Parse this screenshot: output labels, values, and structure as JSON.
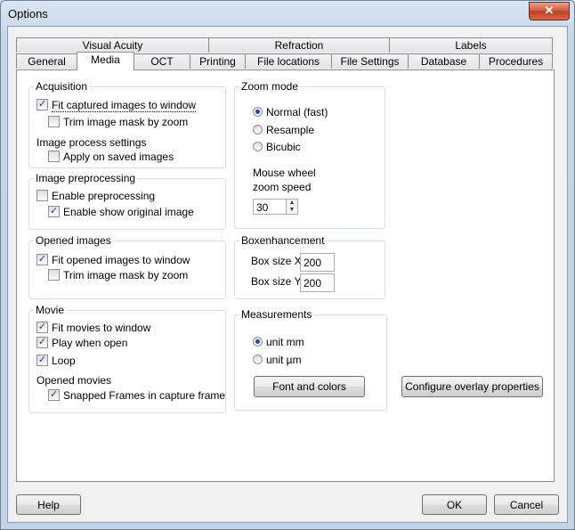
{
  "window": {
    "title": "Options",
    "close_glyph": "✕"
  },
  "tabs_row1": [
    "Visual Acuity",
    "Refraction",
    "Labels"
  ],
  "tabs_row2": [
    "General",
    "Media",
    "OCT",
    "Printing",
    "File locations",
    "File Settings",
    "Database",
    "Procedures"
  ],
  "active_tab": "Media",
  "acquisition": {
    "label": "Acquisition",
    "fit_captured": {
      "label": "Fit captured images to window",
      "checked": true
    },
    "trim_mask": {
      "label": "Trim image mask by zoom",
      "checked": false
    },
    "process_label": "Image process settings",
    "apply_saved": {
      "label": "Apply on saved images",
      "checked": false
    }
  },
  "preprocessing": {
    "label": "Image preprocessing",
    "enable": {
      "label": "Enable preprocessing",
      "checked": false
    },
    "show_original": {
      "label": "Enable show original image",
      "checked": true
    }
  },
  "opened": {
    "label": "Opened images",
    "fit_opened": {
      "label": "Fit opened images to window",
      "checked": true
    },
    "trim_mask": {
      "label": "Trim image mask by zoom",
      "checked": false
    }
  },
  "movie": {
    "label": "Movie",
    "fit_movies": {
      "label": "Fit movies to window",
      "checked": true
    },
    "play_open": {
      "label": "Play when open",
      "checked": true
    },
    "loop": {
      "label": "Loop",
      "checked": true
    },
    "opened_movies_label": "Opened movies",
    "snapped": {
      "label": "Snapped Frames in capture frame",
      "checked": true
    }
  },
  "zoom": {
    "label": "Zoom mode",
    "options": [
      "Normal (fast)",
      "Resample",
      "Bicubic"
    ],
    "selected": "Normal (fast)",
    "wheel_label_1": "Mouse wheel",
    "wheel_label_2": "zoom speed",
    "wheel_value": "30"
  },
  "box": {
    "label": "Boxenhancement",
    "x_label": "Box size X",
    "x_value": "200",
    "y_label": "Box size Y",
    "y_value": "200"
  },
  "measurements": {
    "label": "Measurements",
    "options": [
      "unit mm",
      "unit µm"
    ],
    "selected": "unit mm",
    "font_button": "Font and colors"
  },
  "overlay_button": "Configure overlay properties",
  "footer": {
    "help": "Help",
    "ok": "OK",
    "cancel": "Cancel"
  },
  "icons": {
    "check": "✓",
    "spin_up": "▲",
    "spin_down": "▼"
  }
}
